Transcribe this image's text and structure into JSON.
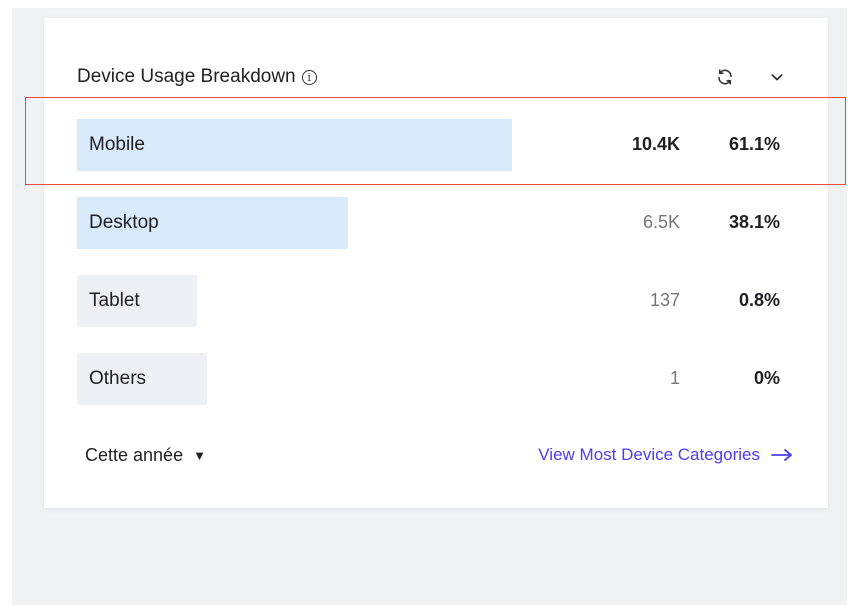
{
  "widget": {
    "title": "Device Usage Breakdown",
    "icons": {
      "info": "info-circle-icon",
      "refresh": "refresh-icon",
      "collapse": "chevron-down-icon"
    }
  },
  "rows": [
    {
      "label": "Mobile",
      "count": "10.4K",
      "percent": "61.1%",
      "share": 0.611
    },
    {
      "label": "Desktop",
      "count": "6.5K",
      "percent": "38.1%",
      "share": 0.381
    },
    {
      "label": "Tablet",
      "count": "137",
      "percent": "0.8%",
      "share": 0.008
    },
    {
      "label": "Others",
      "count": "1",
      "percent": "0%",
      "share": 0.0
    }
  ],
  "footer": {
    "period_label": "Cette année",
    "link_label": "View Most Device Categories"
  },
  "colors": {
    "bar": "#d9eafb",
    "link": "#4d3cf0",
    "highlight": "#e84a4a"
  }
}
